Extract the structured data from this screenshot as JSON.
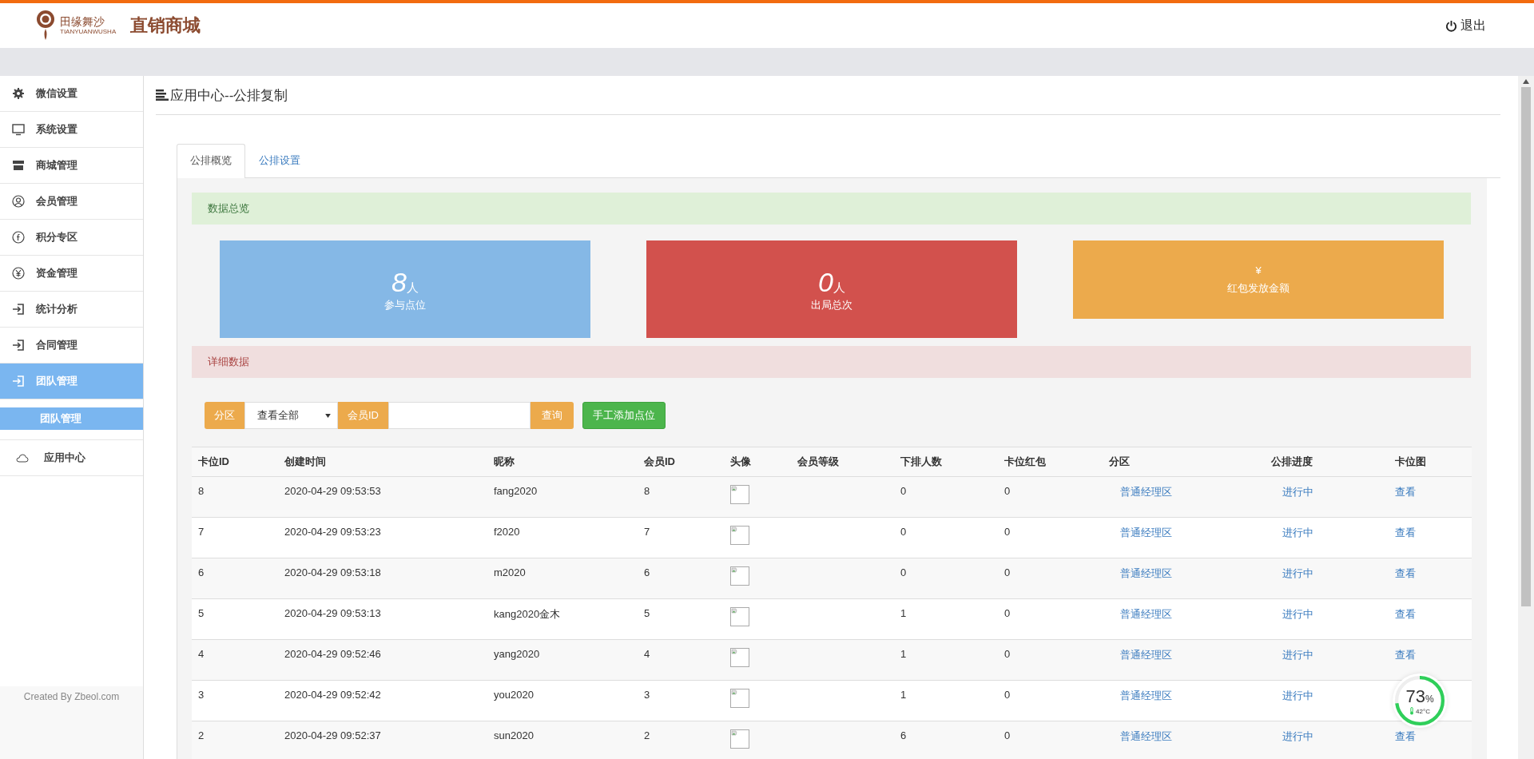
{
  "header": {
    "logo_text": "田缘舞沙",
    "logo_subtext": "TIANYUANWUSHA",
    "title": "直销商城",
    "logout": "退出"
  },
  "sidebar": {
    "items": [
      {
        "label": "微信设置",
        "selected": false
      },
      {
        "label": "系统设置",
        "selected": false
      },
      {
        "label": "商城管理",
        "selected": false
      },
      {
        "label": "会员管理",
        "selected": false
      },
      {
        "label": "积分专区",
        "selected": false
      },
      {
        "label": "资金管理",
        "selected": false
      },
      {
        "label": "统计分析",
        "selected": false
      },
      {
        "label": "合同管理",
        "selected": false
      },
      {
        "label": "团队管理",
        "selected": true,
        "children": [
          {
            "label": "团队管理",
            "selected": true
          }
        ]
      },
      {
        "label": "应用中心",
        "selected": false
      }
    ],
    "footer": "Created By Zbeol.com"
  },
  "page_title": "应用中心--公排复制",
  "tabs": [
    {
      "label": "公排概览",
      "selected": true
    },
    {
      "label": "公排设置",
      "selected": false
    }
  ],
  "overview_heading": "数据总览",
  "stats": [
    {
      "kind": "count",
      "value": "8",
      "unit": "人",
      "label": "参与点位",
      "color": "#85b8e6"
    },
    {
      "kind": "count",
      "value": "0",
      "unit": "人",
      "label": "出局总次",
      "color": "#d2514d"
    },
    {
      "kind": "amount",
      "value": "¥",
      "label": "红包发放金额",
      "color": "#ecaa4c"
    }
  ],
  "detail_heading": "详细数据",
  "filters": {
    "zone_label": "分区",
    "zone_value": "查看全部",
    "member_label": "会员ID",
    "search_button": "查询",
    "add_button": "手工添加点位"
  },
  "table": {
    "columns": [
      "卡位ID",
      "创建时间",
      "昵称",
      "会员ID",
      "头像",
      "会员等级",
      "下排人数",
      "卡位红包",
      "分区",
      "公排进度",
      "卡位图"
    ],
    "rows": [
      {
        "id": "8",
        "created": "2020-04-29 09:53:53",
        "nickname": "fang2020",
        "member_id": "8",
        "downline": "0",
        "red_packet": "0",
        "zone": "普通经理区",
        "progress": "进行中",
        "map": "查看"
      },
      {
        "id": "7",
        "created": "2020-04-29 09:53:23",
        "nickname": "f2020",
        "member_id": "7",
        "downline": "0",
        "red_packet": "0",
        "zone": "普通经理区",
        "progress": "进行中",
        "map": "查看"
      },
      {
        "id": "6",
        "created": "2020-04-29 09:53:18",
        "nickname": "m2020",
        "member_id": "6",
        "downline": "0",
        "red_packet": "0",
        "zone": "普通经理区",
        "progress": "进行中",
        "map": "查看"
      },
      {
        "id": "5",
        "created": "2020-04-29 09:53:13",
        "nickname": "kang2020金木",
        "member_id": "5",
        "downline": "1",
        "red_packet": "0",
        "zone": "普通经理区",
        "progress": "进行中",
        "map": "查看"
      },
      {
        "id": "4",
        "created": "2020-04-29 09:52:46",
        "nickname": "yang2020",
        "member_id": "4",
        "downline": "1",
        "red_packet": "0",
        "zone": "普通经理区",
        "progress": "进行中",
        "map": "查看"
      },
      {
        "id": "3",
        "created": "2020-04-29 09:52:42",
        "nickname": "you2020",
        "member_id": "3",
        "downline": "1",
        "red_packet": "0",
        "zone": "普通经理区",
        "progress": "进行中"
      },
      {
        "id": "2",
        "created": "2020-04-29 09:52:37",
        "nickname": "sun2020",
        "member_id": "2",
        "downline": "6",
        "red_packet": "0",
        "zone": "普通经理区",
        "progress": "进行中",
        "map": "查看"
      }
    ]
  },
  "monitor": {
    "level": 0.73,
    "reading": "73",
    "unit": "%",
    "temperature": "42°C"
  }
}
